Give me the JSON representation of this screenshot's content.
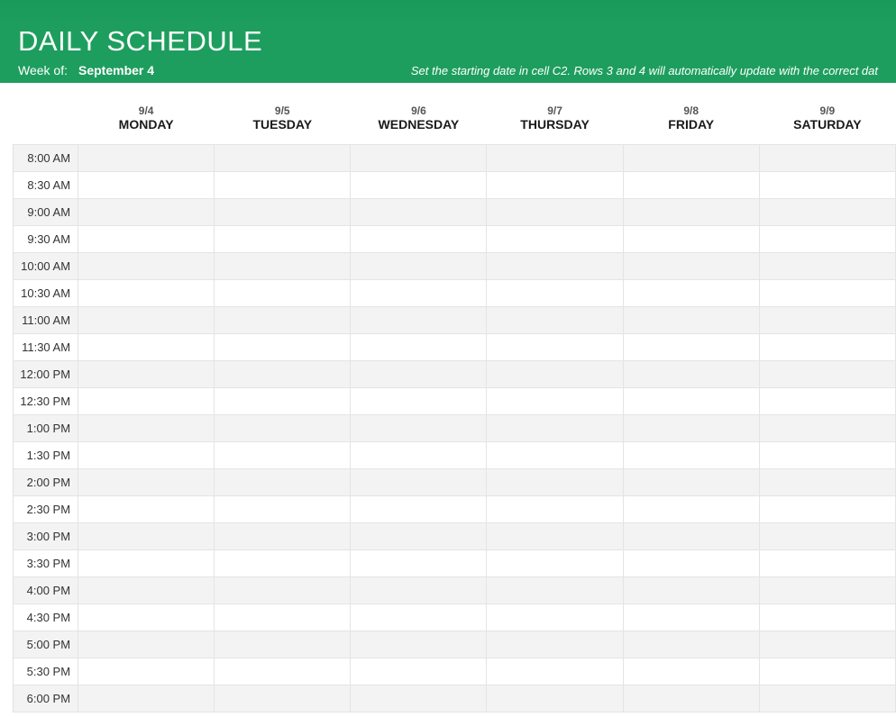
{
  "header": {
    "title": "DAILY SCHEDULE",
    "week_of_label": "Week of:",
    "week_of_value": "September 4",
    "instruction": "Set the starting date in cell C2. Rows 3 and 4 will automatically update with the correct dat"
  },
  "columns": [
    {
      "date": "9/4",
      "day": "MONDAY"
    },
    {
      "date": "9/5",
      "day": "TUESDAY"
    },
    {
      "date": "9/6",
      "day": "WEDNESDAY"
    },
    {
      "date": "9/7",
      "day": "THURSDAY"
    },
    {
      "date": "9/8",
      "day": "FRIDAY"
    },
    {
      "date": "9/9",
      "day": "SATURDAY"
    }
  ],
  "times": [
    "8:00 AM",
    "8:30 AM",
    "9:00 AM",
    "9:30 AM",
    "10:00 AM",
    "10:30 AM",
    "11:00 AM",
    "11:30 AM",
    "12:00 PM",
    "12:30 PM",
    "1:00 PM",
    "1:30 PM",
    "2:00 PM",
    "2:30 PM",
    "3:00 PM",
    "3:30 PM",
    "4:00 PM",
    "4:30 PM",
    "5:00 PM",
    "5:30 PM",
    "6:00 PM"
  ]
}
